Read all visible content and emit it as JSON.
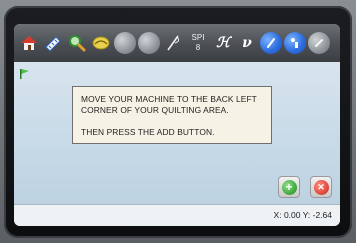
{
  "toolbar": {
    "spi_label": "SPI",
    "spi_value": "8",
    "h_glyph": "ℋ",
    "v_glyph": "V",
    "italic_v": "ν"
  },
  "message": {
    "line1": "MOVE YOUR MACHINE TO THE BACK LEFT",
    "line2": "CORNER OF YOUR QUILTING AREA.",
    "line3": "THEN PRESS THE ADD BUTTON."
  },
  "buttons": {
    "add_glyph": "+",
    "cancel_glyph": "✕"
  },
  "status": {
    "coordinates": "X: 0.00 Y: -2.64"
  },
  "colors": {
    "add_green": "#4caf50",
    "cancel_red": "#e0473b",
    "toolbar_blue": "#2e6fe0"
  },
  "icons": [
    "home-icon",
    "ruler-icon",
    "magnify-icon",
    "pencil-icon",
    "gray-circle-icon",
    "gray-circle-icon",
    "needle-icon",
    "h-icon",
    "v-icon",
    "help-icon",
    "info-icon",
    "gray-circle-icon",
    "flag-icon"
  ]
}
